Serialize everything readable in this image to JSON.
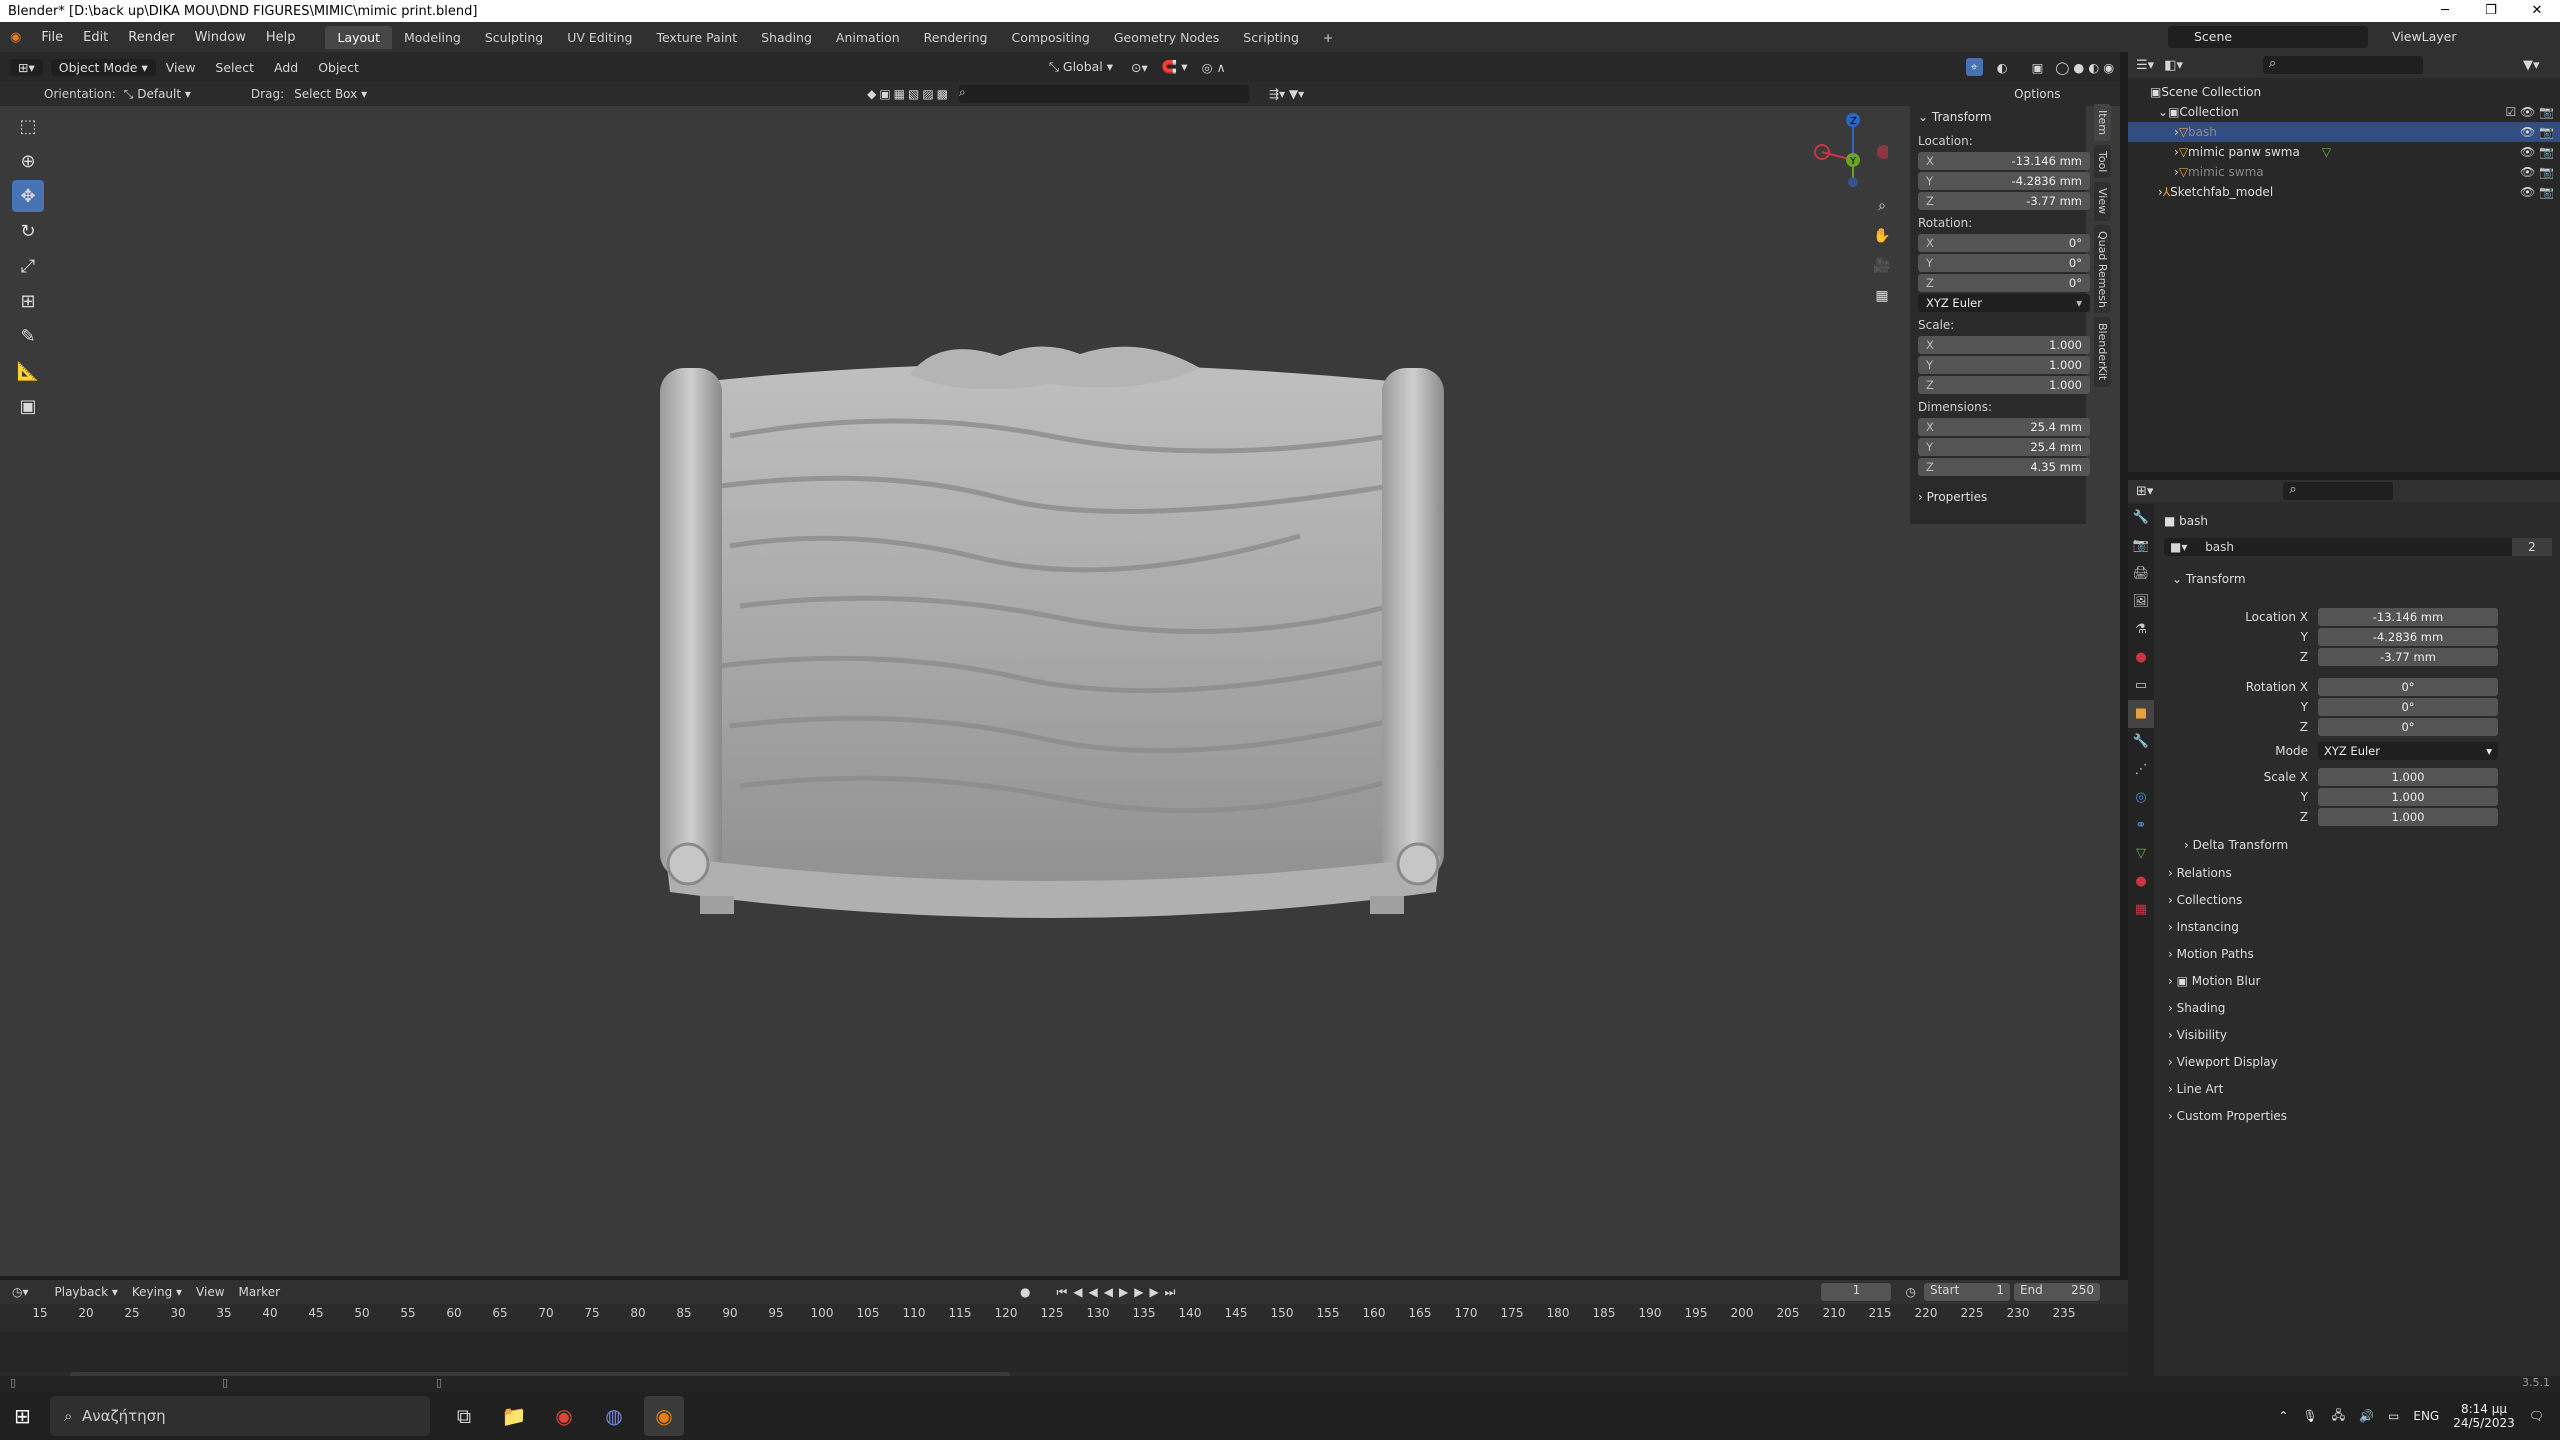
{
  "titlebar": {
    "title": "Blender* [D:\\back up\\DIKA MOU\\DND FIGURES\\MIMIC\\mimic print.blend]"
  },
  "menu": {
    "items": [
      "File",
      "Edit",
      "Render",
      "Window",
      "Help"
    ]
  },
  "workspaces": [
    "Layout",
    "Modeling",
    "Sculpting",
    "UV Editing",
    "Texture Paint",
    "Shading",
    "Animation",
    "Rendering",
    "Compositing",
    "Geometry Nodes",
    "Scripting"
  ],
  "scene": {
    "name": "Scene",
    "viewlayer": "ViewLayer"
  },
  "viewport_header": {
    "mode": "Object Mode",
    "menus": [
      "View",
      "Select",
      "Add",
      "Object"
    ],
    "transform": "Global",
    "options": "Options"
  },
  "viewport_sub": {
    "orientation_label": "Orientation:",
    "orientation": "Default",
    "drag_label": "Drag:",
    "drag": "Select Box"
  },
  "npanel": {
    "transform": "Transform",
    "location_label": "Location:",
    "location": {
      "x": "-13.146 mm",
      "y": "-4.2836 mm",
      "z": "-3.77 mm"
    },
    "rotation_label": "Rotation:",
    "rotation": {
      "x": "0°",
      "y": "0°",
      "z": "0°"
    },
    "rotation_mode": "XYZ Euler",
    "scale_label": "Scale:",
    "scale": {
      "x": "1.000",
      "y": "1.000",
      "z": "1.000"
    },
    "dimensions_label": "Dimensions:",
    "dimensions": {
      "x": "25.4 mm",
      "y": "25.4 mm",
      "z": "4.35 mm"
    },
    "properties": "Properties",
    "tabs": [
      "Item",
      "Tool",
      "View",
      "Quad Remesh",
      "BlenderKit"
    ],
    "axis": {
      "x": "X",
      "y": "Y",
      "z": "Z"
    }
  },
  "outliner": {
    "rows": [
      {
        "label": "Scene Collection"
      },
      {
        "label": "Collection"
      },
      {
        "label": "bash"
      },
      {
        "label": "mimic panw swma"
      },
      {
        "label": "mimic swma"
      },
      {
        "label": "Sketchfab_model"
      }
    ]
  },
  "properties": {
    "object_name": "bash",
    "data_name": "bash",
    "users": "2",
    "transform": "Transform",
    "location_x_label": "Location X",
    "y": "Y",
    "z": "Z",
    "location": {
      "x": "-13.146 mm",
      "y": "-4.2836 mm",
      "z": "-3.77 mm"
    },
    "rotation_x_label": "Rotation X",
    "rotation": {
      "x": "0°",
      "y": "0°",
      "z": "0°"
    },
    "mode_label": "Mode",
    "mode": "XYZ Euler",
    "scale_x_label": "Scale X",
    "scale": {
      "x": "1.000",
      "y": "1.000",
      "z": "1.000"
    },
    "sections": [
      "Delta Transform",
      "Relations",
      "Collections",
      "Instancing",
      "Motion Paths",
      "Motion Blur",
      "Shading",
      "Visibility",
      "Viewport Display",
      "Line Art",
      "Custom Properties"
    ]
  },
  "timeline": {
    "menus": [
      "Playback",
      "Keying",
      "View",
      "Marker"
    ],
    "frame": "1",
    "start_label": "Start",
    "start": "1",
    "end_label": "End",
    "end": "250",
    "ticks": [
      "15",
      "20",
      "25",
      "30",
      "35",
      "40",
      "45",
      "50",
      "55",
      "60",
      "65",
      "70",
      "75",
      "80",
      "85",
      "90",
      "95",
      "100",
      "105",
      "110",
      "115",
      "120",
      "125",
      "130",
      "135",
      "140",
      "145",
      "150",
      "155",
      "160",
      "165",
      "170",
      "175",
      "180",
      "185",
      "190",
      "195",
      "200",
      "205",
      "210",
      "215",
      "220",
      "225",
      "230",
      "235"
    ]
  },
  "status": {
    "version": "3.5.1"
  },
  "taskbar": {
    "search": "Αναζήτηση",
    "lang": "ENG",
    "time": "8:14 μμ",
    "date": "24/5/2023"
  }
}
